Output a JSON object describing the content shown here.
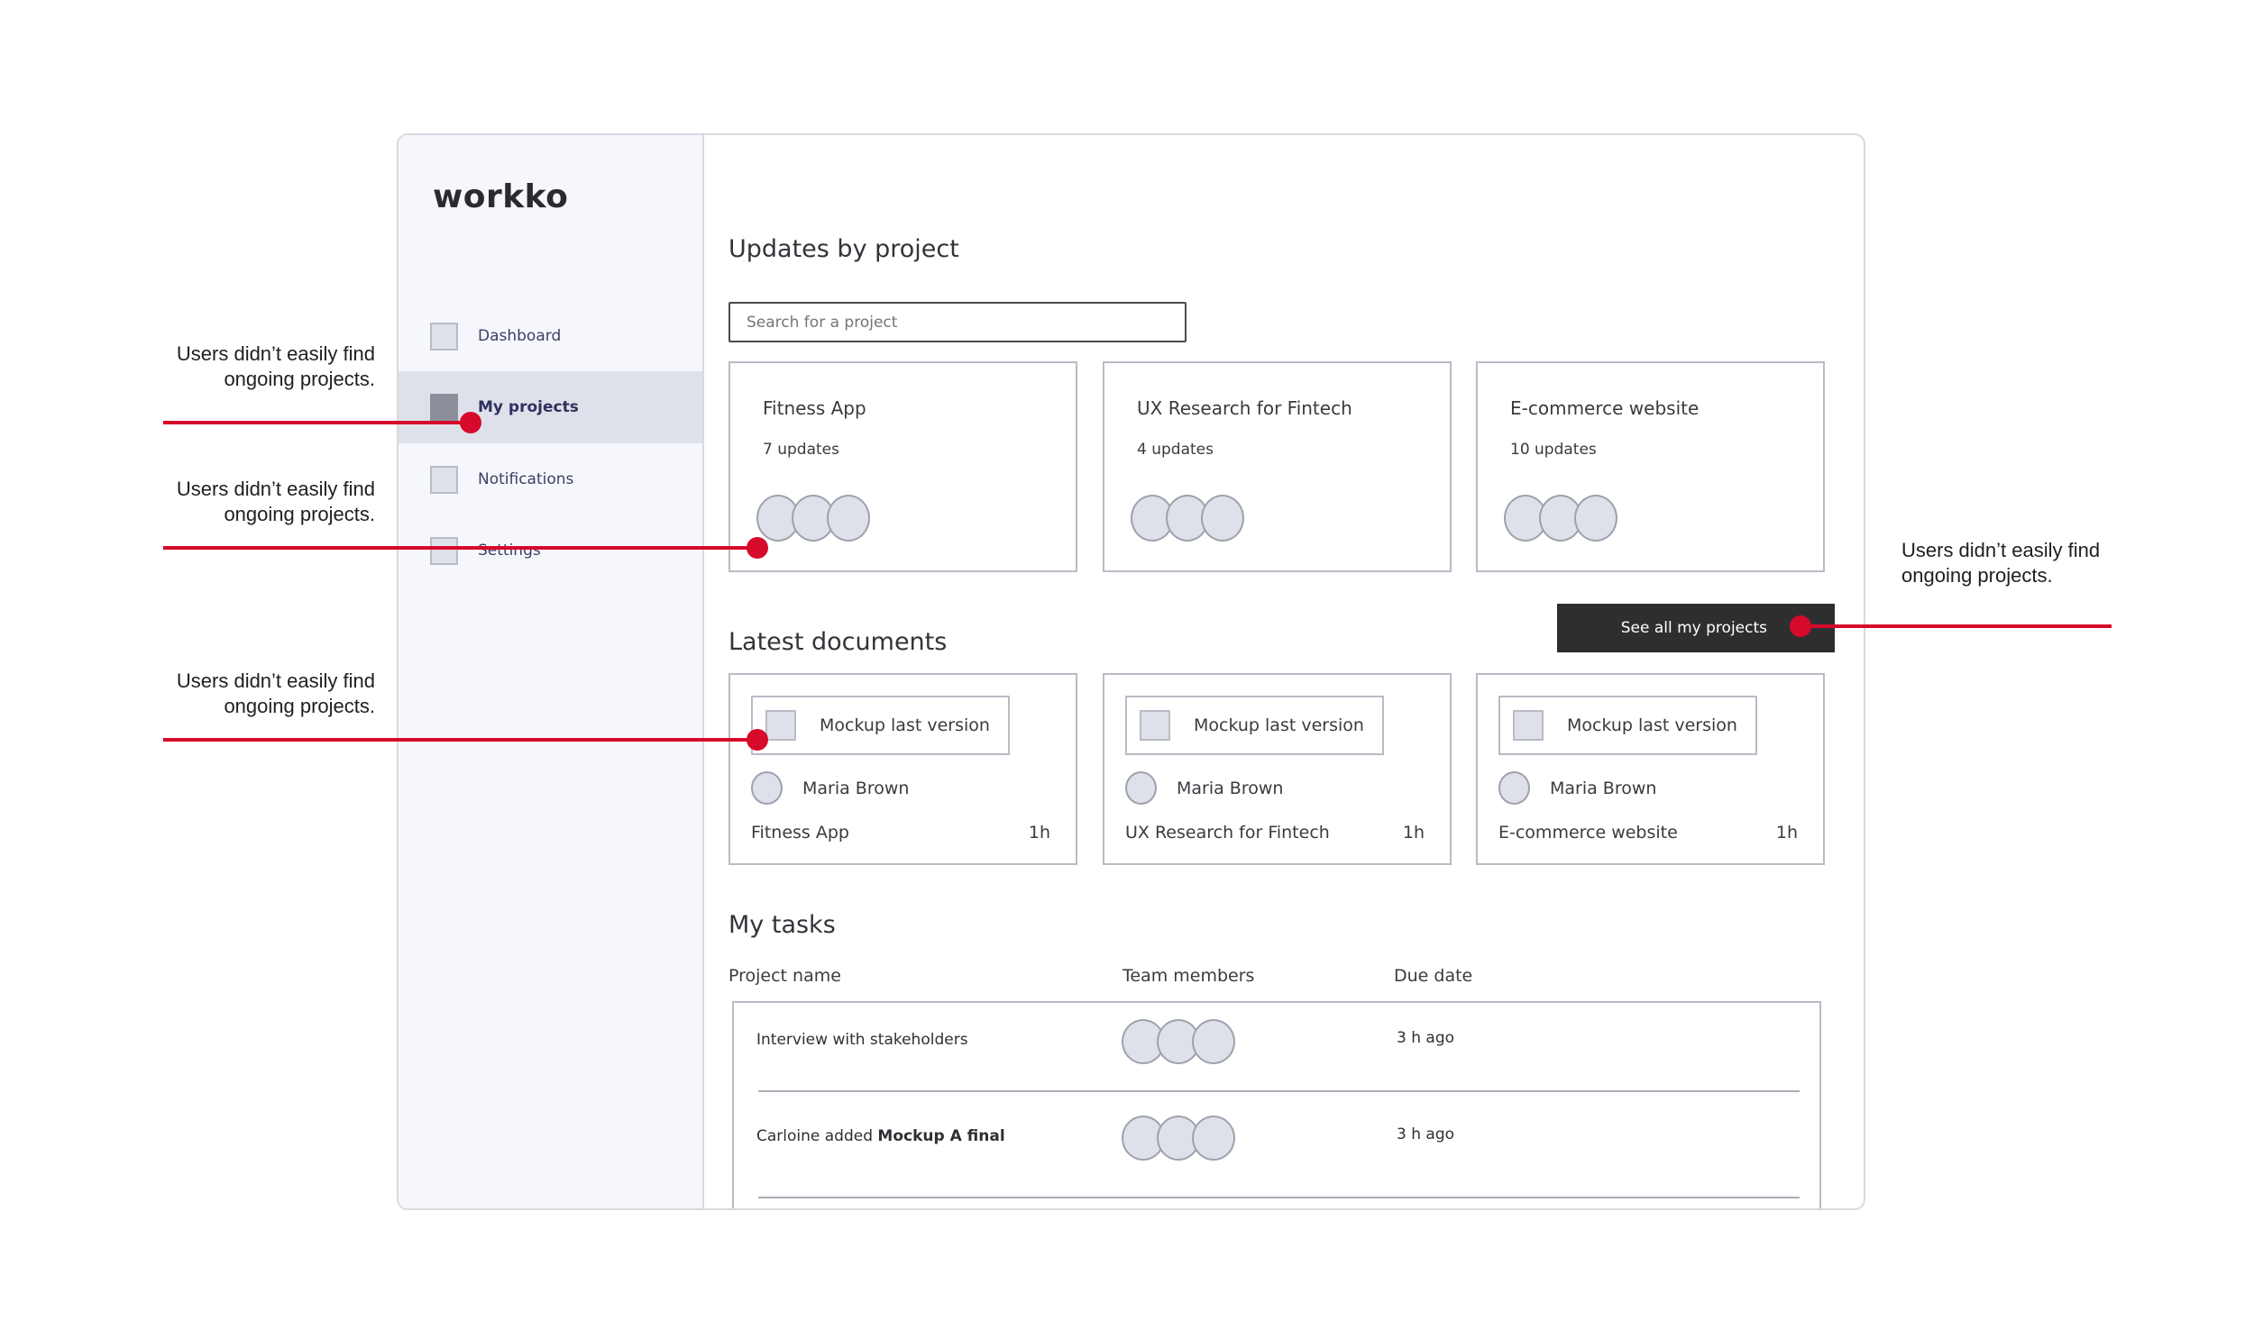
{
  "app": {
    "logo": "workko"
  },
  "sidebar": {
    "items": [
      {
        "label": "Dashboard",
        "active": false
      },
      {
        "label": "My projects",
        "active": true
      },
      {
        "label": "Notifications",
        "active": false
      },
      {
        "label": "Settings",
        "active": false
      }
    ]
  },
  "updates": {
    "title": "Updates by project",
    "search_placeholder": "Search for a project",
    "search_value": "",
    "projects": [
      {
        "name": "Fitness App",
        "count": "7 updates"
      },
      {
        "name": "UX Research for Fintech",
        "count": "4 updates"
      },
      {
        "name": "E-commerce website",
        "count": "10 updates"
      }
    ],
    "see_all_label": "See all my projects"
  },
  "documents": {
    "title": "Latest documents",
    "items": [
      {
        "file": "Mockup last version",
        "user": "Maria Brown",
        "project": "Fitness App",
        "time": "1h"
      },
      {
        "file": "Mockup last version",
        "user": "Maria Brown",
        "project": "UX Research for Fintech",
        "time": "1h"
      },
      {
        "file": "Mockup last version",
        "user": "Maria Brown",
        "project": "E-commerce website",
        "time": "1h"
      }
    ]
  },
  "tasks": {
    "title": "My tasks",
    "columns": [
      "Project name",
      "Team members",
      "Due date"
    ],
    "rows": [
      {
        "name": "Interview with stakeholders",
        "name_bold": "",
        "due": "3 h ago"
      },
      {
        "name": "Carloine added ",
        "name_bold": "Mockup A final",
        "due": "3 h ago"
      }
    ]
  },
  "annotations": [
    {
      "text_line1": "Users didn’t easily find",
      "text_line2": "ongoing projects.",
      "side": "left",
      "target": "sidebar-item-my-projects"
    },
    {
      "text_line1": "Users didn’t easily find",
      "text_line2": "ongoing projects.",
      "side": "left",
      "target": "project-card-fitness-app"
    },
    {
      "text_line1": "Users didn’t easily find",
      "text_line2": "ongoing projects.",
      "side": "left",
      "target": "doc-card-fitness-app"
    },
    {
      "text_line1": "Users didn’t easily find",
      "text_line2": "ongoing projects.",
      "side": "right",
      "target": "see-all-projects-button"
    }
  ],
  "colors": {
    "annotation_red": "#d60a2b",
    "button_dark": "#2e2e31",
    "sidebar_bg": "#f6f7fc",
    "active_bg": "#dfe1ea",
    "placeholder_fill": "#dfe1ea"
  }
}
